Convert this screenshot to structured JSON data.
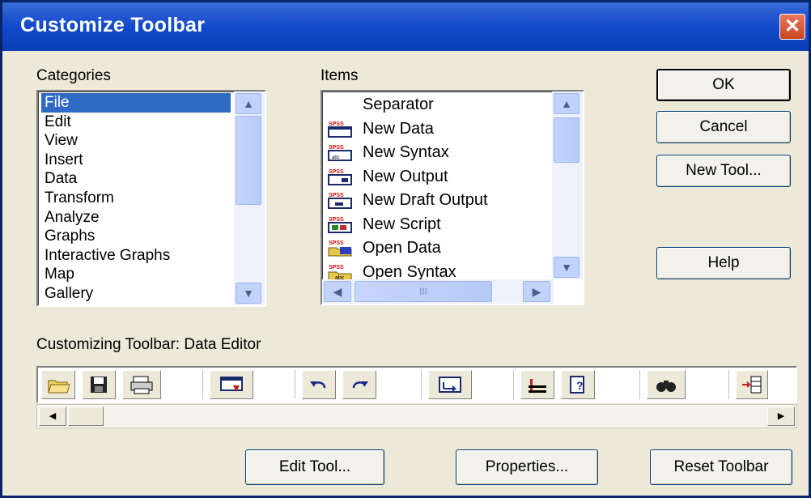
{
  "window": {
    "title": "Customize Toolbar"
  },
  "categories": {
    "label": "Categories",
    "items": [
      "File",
      "Edit",
      "View",
      "Insert",
      "Data",
      "Transform",
      "Analyze",
      "Graphs",
      "Interactive Graphs",
      "Map",
      "Gallery"
    ],
    "selected": "File"
  },
  "items": {
    "label": "Items",
    "list": [
      {
        "label": "Separator",
        "icon": "separator-icon"
      },
      {
        "label": "New Data",
        "icon": "new-data-icon"
      },
      {
        "label": "New Syntax",
        "icon": "new-syntax-icon"
      },
      {
        "label": "New Output",
        "icon": "new-output-icon"
      },
      {
        "label": "New Draft Output",
        "icon": "new-draft-output-icon"
      },
      {
        "label": "New Script",
        "icon": "new-script-icon"
      },
      {
        "label": "Open Data",
        "icon": "open-data-icon"
      },
      {
        "label": "Open Syntax",
        "icon": "open-syntax-icon"
      }
    ],
    "scroll_thumb_text": "III"
  },
  "buttons": {
    "ok": "OK",
    "cancel": "Cancel",
    "new_tool": "New Tool...",
    "help": "Help",
    "edit_tool": "Edit Tool...",
    "properties": "Properties...",
    "reset_toolbar": "Reset Toolbar"
  },
  "customizing": {
    "label": "Customizing Toolbar: Data Editor",
    "tools": [
      "open-file-icon",
      "save-icon",
      "print-icon",
      "blank",
      "dialog-recall-icon",
      "blank",
      "undo-icon",
      "redo-icon",
      "blank",
      "goto-case-icon",
      "blank",
      "insert-variable-icon",
      "variables-icon",
      "blank",
      "find-icon",
      "blank",
      "insert-case-icon"
    ]
  },
  "colors": {
    "titlebar": "#0f48c8",
    "selection": "#316ac5",
    "dialog_bg": "#ece9d8"
  }
}
